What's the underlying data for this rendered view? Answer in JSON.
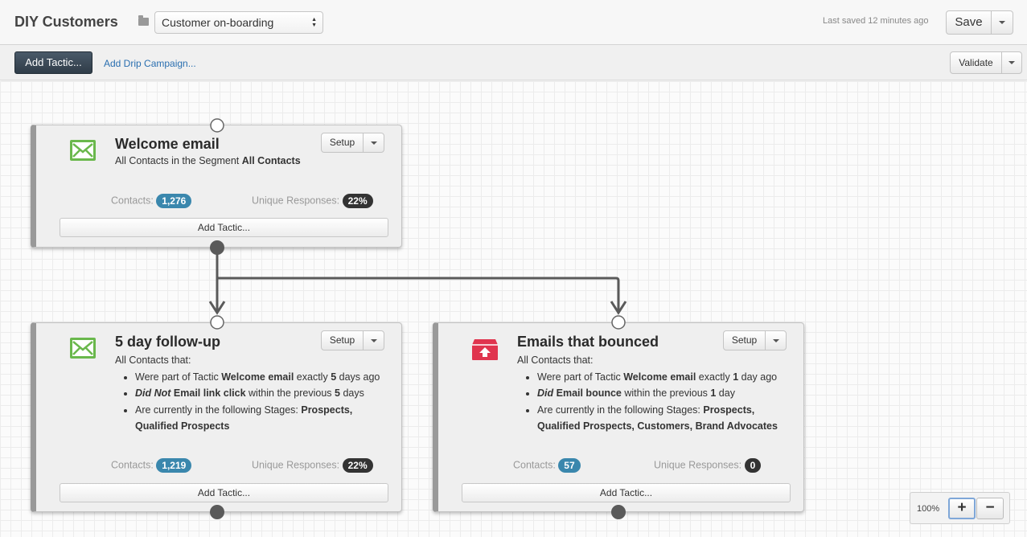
{
  "header": {
    "app_title": "DIY Customers",
    "program_select": "Customer on-boarding",
    "last_saved": "Last saved 12 minutes ago",
    "save_label": "Save"
  },
  "toolbar": {
    "add_tactic_label": "Add Tactic...",
    "drip_link": "Add Drip Campaign...",
    "validate_label": "Validate"
  },
  "colors": {
    "accent": "#3a87ad",
    "primary_button": "#34414d",
    "email_icon": "#6ab84c",
    "bounce_icon": "#e0344e"
  },
  "cards": [
    {
      "icon": "envelope-icon",
      "title": "Welcome email",
      "sub_prefix": "All Contacts in the Segment ",
      "sub_bold": "All Contacts",
      "setup_label": "Setup",
      "contacts_label": "Contacts:",
      "contacts_value": "1,276",
      "responses_label": "Unique Responses:",
      "responses_value": "22%",
      "add_label": "Add Tactic..."
    },
    {
      "icon": "envelope-icon",
      "title": "5 day follow-up",
      "intro": "All Contacts that:",
      "rules": [
        {
          "t1": "Were part of Tactic ",
          "b1": "Welcome email",
          "t2": " exactly ",
          "b2": "5",
          "t3": " days ago"
        },
        {
          "i1": "Did Not",
          "b1": " Email link click",
          "t2": " within the previous ",
          "b2": "5",
          "t3": " days"
        },
        {
          "t1": "Are currently in the following Stages: ",
          "b1": "Prospects, Qualified Prospects"
        }
      ],
      "setup_label": "Setup",
      "contacts_label": "Contacts:",
      "contacts_value": "1,219",
      "responses_label": "Unique Responses:",
      "responses_value": "22%",
      "add_label": "Add Tactic..."
    },
    {
      "icon": "bounce-icon",
      "title": "Emails that bounced",
      "intro": "All Contacts that:",
      "rules": [
        {
          "t1": "Were part of Tactic ",
          "b1": "Welcome email",
          "t2": " exactly ",
          "b2": "1",
          "t3": " day ago"
        },
        {
          "i1": "Did",
          "b1": " Email bounce",
          "t2": " within the previous ",
          "b2": "1",
          "t3": " day"
        },
        {
          "t1": "Are currently in the following Stages: ",
          "b1": "Prospects, Qualified Prospects, Customers, Brand Advocates"
        }
      ],
      "setup_label": "Setup",
      "contacts_label": "Contacts:",
      "contacts_value": "57",
      "responses_label": "Unique Responses:",
      "responses_value": "0",
      "add_label": "Add Tactic..."
    }
  ],
  "zoom": {
    "level": "100%",
    "in_label": "+",
    "out_label": "−"
  }
}
